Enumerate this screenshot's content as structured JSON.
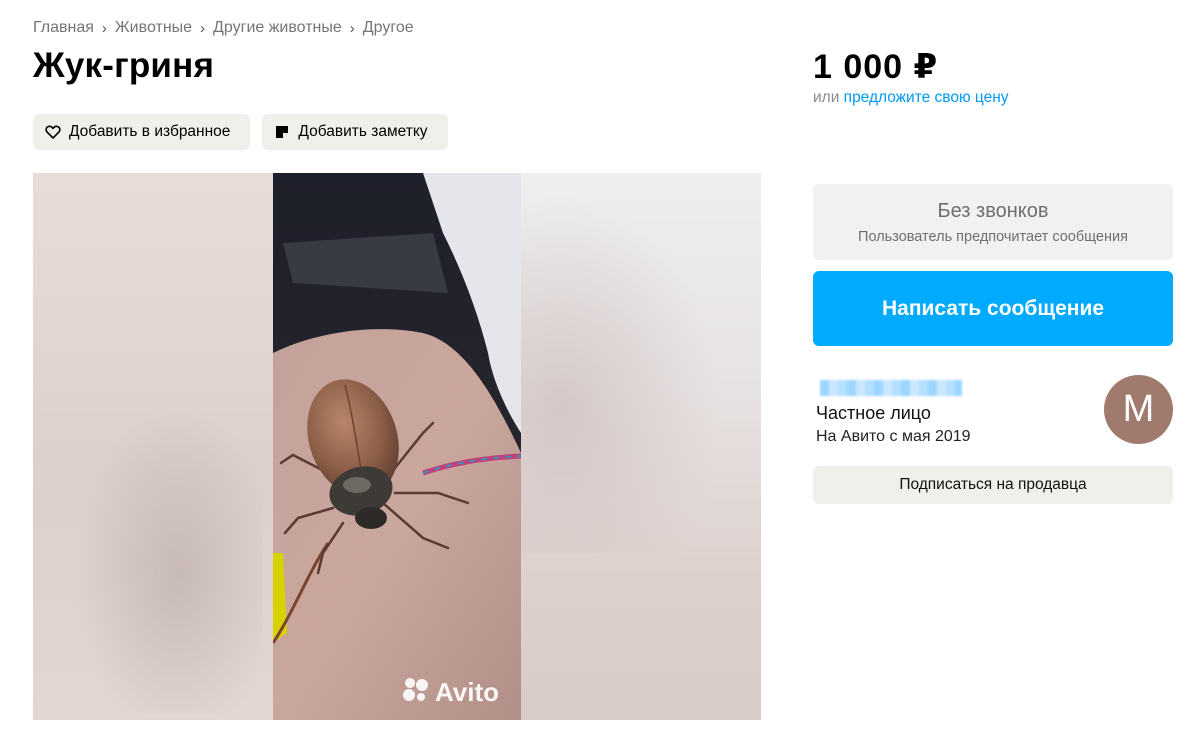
{
  "breadcrumb": {
    "items": [
      "Главная",
      "Животные",
      "Другие животные",
      "Другое"
    ],
    "separator": "›"
  },
  "listing": {
    "title": "Жук-гриня",
    "price": "1 000 ₽",
    "price_offer_prefix": "или ",
    "price_offer_link": "предложите свою цену"
  },
  "actions": {
    "favorite_label": "Добавить в избранное",
    "favorite_icon": "heart-icon",
    "note_label": "Добавить заметку",
    "note_icon": "note-icon"
  },
  "gallery": {
    "watermark": "Avito"
  },
  "contact": {
    "no_calls_title": "Без звонков",
    "no_calls_subtitle": "Пользователь предпочитает сообщения",
    "message_button": "Написать сообщение"
  },
  "seller": {
    "type": "Частное лицо",
    "since": "На Авито с мая 2019",
    "avatar_letter": "М",
    "subscribe_button": "Подписаться на продавца"
  },
  "colors": {
    "accent_blue": "#00aaff",
    "link_blue": "#0099f7",
    "avatar": "#a07b6d",
    "button_beige": "#f1efea"
  }
}
